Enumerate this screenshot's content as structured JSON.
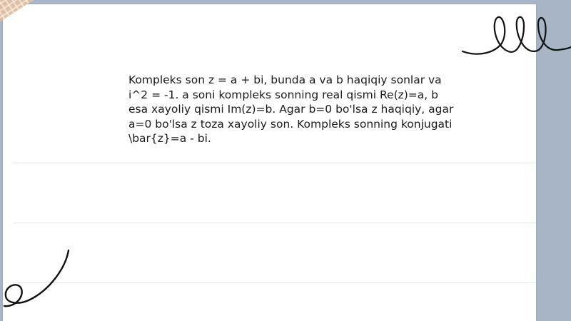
{
  "content": {
    "paragraph": "Kompleks son z = a + bi, bunda a va b haqiqiy sonlar va i^2 = -1. a soni kompleks sonning real qismi Re(z)=a, b esa xayoliy qismi Im(z)=b. Agar b=0 bo'lsa z haqiqiy, agar a=0 bo'lsa z toza xayoliy son. Kompleks sonning konjugati \\bar{z}=a - bi."
  },
  "decorations": {
    "background_color": "#a7b5c6",
    "paper_color": "#ffffff",
    "tape_color": "#e1bfa0",
    "scribble_color": "#111111"
  }
}
